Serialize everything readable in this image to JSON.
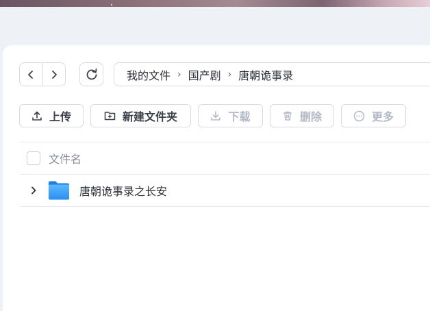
{
  "colors": {
    "page_bg": "#eef1f6",
    "panel_bg": "#ffffff",
    "border": "#d7dbe3",
    "text": "#2b2f36",
    "muted": "#8a909a",
    "disabled": "#b3b9c4",
    "folder_blue": "#2f95f5"
  },
  "breadcrumb": {
    "items": [
      "我的文件",
      "国产剧",
      "唐朝诡事录"
    ],
    "separator": "›"
  },
  "toolbar": {
    "upload": {
      "label": "上传",
      "icon": "upload-icon",
      "enabled": true
    },
    "new_folder": {
      "label": "新建文件夹",
      "icon": "folder-plus-icon",
      "enabled": true
    },
    "download": {
      "label": "下载",
      "icon": "download-icon",
      "enabled": false
    },
    "delete": {
      "label": "删除",
      "icon": "trash-icon",
      "enabled": false
    },
    "more": {
      "label": "更多",
      "icon": "more-icon",
      "enabled": false
    }
  },
  "table": {
    "columns": [
      "文件名"
    ],
    "rows": [
      {
        "name": "唐朝诡事录之长安",
        "type": "folder",
        "icon": "folder-icon"
      }
    ]
  }
}
